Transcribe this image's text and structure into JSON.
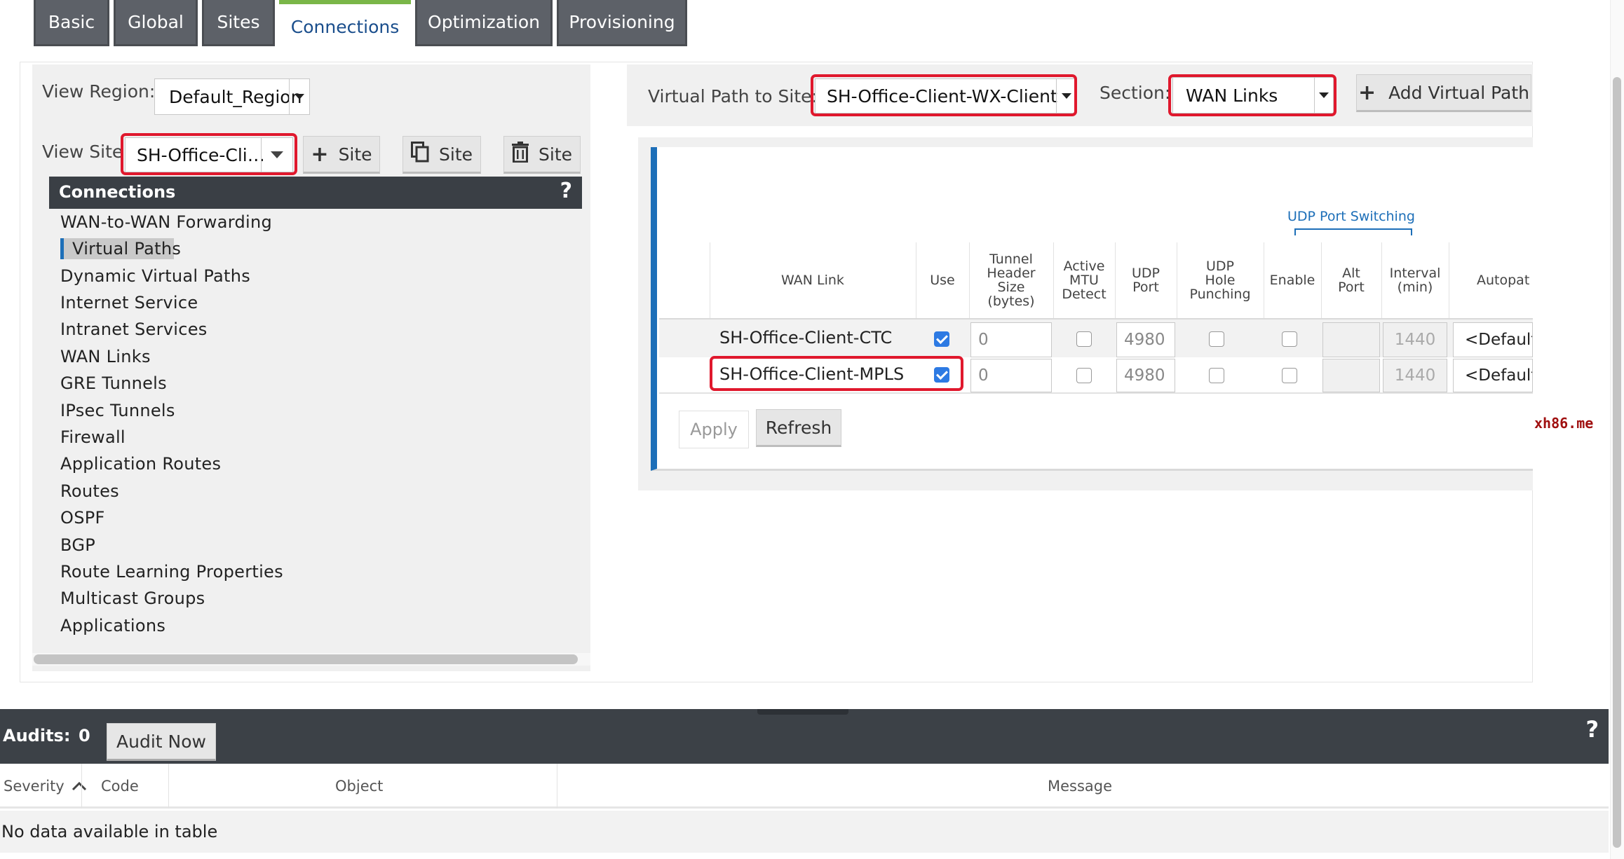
{
  "tabs": [
    {
      "label": "Basic"
    },
    {
      "label": "Global"
    },
    {
      "label": "Sites"
    },
    {
      "label": "Connections"
    },
    {
      "label": "Optimization"
    },
    {
      "label": "Provisioning"
    }
  ],
  "left": {
    "view_region_label": "View Region:",
    "view_region_value": "Default_Region",
    "view_site_label": "View Site:",
    "view_site_value": "SH-Office-Cli…",
    "add_site_label": "Site",
    "copy_site_label": "Site",
    "delete_site_label": "Site",
    "connections_header": "Connections",
    "help": "?",
    "nav": [
      "WAN-to-WAN Forwarding",
      "Virtual Paths",
      "Dynamic Virtual Paths",
      "Internet Service",
      "Intranet Services",
      "WAN Links",
      "GRE Tunnels",
      "IPsec Tunnels",
      "Firewall",
      "Application Routes",
      "Routes",
      "OSPF",
      "BGP",
      "Route Learning Properties",
      "Multicast Groups",
      "Applications"
    ]
  },
  "right": {
    "vpath_label": "Virtual Path to Site:",
    "vpath_value": "SH-Office-Client-WX-Client",
    "section_label": "Section:",
    "section_value": "WAN Links",
    "add_vpath_label": "Add Virtual Path",
    "udp_group_label": "UDP Port Switching",
    "headers": {
      "wan_link": "WAN Link",
      "use": "Use",
      "tunnel": [
        "Tunnel",
        "Header",
        "Size",
        "(bytes)"
      ],
      "mtu": [
        "Active",
        "MTU",
        "Detect"
      ],
      "udp_port": [
        "UDP",
        "Port"
      ],
      "hole": [
        "UDP",
        "Hole",
        "Punching"
      ],
      "enable": "Enable",
      "alt_port": [
        "Alt",
        "Port"
      ],
      "interval": [
        "Interval",
        "(min)"
      ],
      "autopath": "Autopat"
    },
    "rows": [
      {
        "wan_link": "SH-Office-Client-CTC",
        "use": true,
        "tunnel": "0",
        "mtu": false,
        "udp_port": "4980",
        "hole": false,
        "enable": false,
        "alt_port": "",
        "interval": "1440",
        "autopath": "<Default>"
      },
      {
        "wan_link": "SH-Office-Client-MPLS",
        "use": true,
        "tunnel": "0",
        "mtu": false,
        "udp_port": "4980",
        "hole": false,
        "enable": false,
        "alt_port": "",
        "interval": "1440",
        "autopath": "<Default>"
      }
    ],
    "apply_label": "Apply",
    "refresh_label": "Refresh",
    "watermark": "xh86.me"
  },
  "audits": {
    "label": "Audits:",
    "count": "0",
    "audit_now_label": "Audit Now",
    "help": "?",
    "columns": [
      "Severity",
      "Code",
      "Object",
      "Message"
    ],
    "empty_text": "No data available in table"
  }
}
